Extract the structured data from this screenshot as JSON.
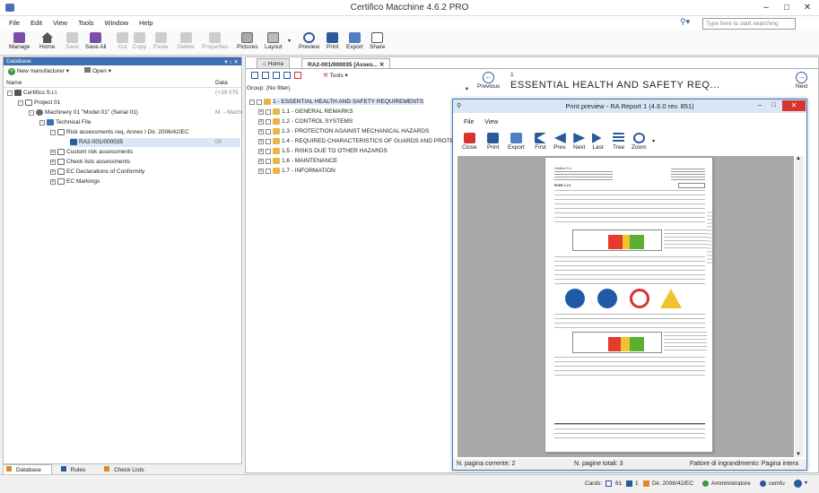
{
  "app_title": "Certifico Macchine 4.6.2 PRO",
  "menu": [
    "File",
    "Edit",
    "View",
    "Tools",
    "Window",
    "Help"
  ],
  "search_placeholder": "Type here to start searching",
  "toolbar": {
    "manage": "Manage",
    "home": "Home",
    "save": "Save",
    "save_all": "Save All",
    "cut": "Cut",
    "copy": "Copy",
    "paste": "Paste",
    "delete": "Delete",
    "properties": "Properties",
    "pictures": "Pictures",
    "layout": "Layout",
    "preview": "Preview",
    "print": "Print",
    "export": "Export",
    "share": "Share"
  },
  "database_panel": {
    "title": "Database",
    "new_manufacturer": "New manufacturer",
    "open": "Open",
    "col_name": "Name",
    "col_data": "Data",
    "tree": [
      {
        "label": "Certifico S.r.l.",
        "data": "(+39 075"
      },
      {
        "label": "Project 01",
        "data": ""
      },
      {
        "label": "Machinery 01 \"Model 01\" (Serial 01)",
        "data": "M. - Machi"
      },
      {
        "label": "Technical File",
        "data": ""
      },
      {
        "label": "Risk assessments req. Annex I Dir. 2006/42/EC",
        "data": ""
      },
      {
        "label": "RA2-001/000035",
        "data": "00"
      },
      {
        "label": "Custom risk assessments",
        "data": ""
      },
      {
        "label": "Check lists assessments",
        "data": ""
      },
      {
        "label": "EC Declarations of Conformity",
        "data": ""
      },
      {
        "label": "EC Markings",
        "data": ""
      }
    ],
    "bottom_tabs": [
      "Database",
      "Rules",
      "Check Lists"
    ]
  },
  "doc_tabs": {
    "home": "Home",
    "active": "RA2-001/000035 [Asses..."
  },
  "tools_label": "Tools",
  "group_filter": "Group: (No filter)",
  "requirements": [
    "1 - ESSENTIAL HEALTH AND SAFETY REQUIREMENTS",
    "1.1 - GENERAL REMARKS",
    "1.2 - CONTROL SYSTEMS",
    "1.3 - PROTECTION AGAINST MECHANICAL HAZARDS",
    "1.4 - REQUIRED CHARACTERISTICS OF GUARDS AND PROTECT",
    "1.5 - RISKS DUE TO OTHER HAZARDS",
    "1.6 - MAINTENANCE",
    "1.7 - INFORMATION"
  ],
  "nav": {
    "previous": "Previous",
    "next": "Next",
    "page_num": "1",
    "heading": "ESSENTIAL HEALTH AND SAFETY REQ..."
  },
  "preview": {
    "title": "Print preview - RA Report 1 (4.6.0 rev. 851)",
    "menu": [
      "File",
      "View"
    ],
    "buttons": [
      "Close",
      "Print",
      "Export",
      "First",
      "Prev.",
      "Next",
      "Last",
      "Tree",
      "Zoom"
    ],
    "status_current": "N. pagina corrente: 2",
    "status_total": "N. pagine totali: 3",
    "status_zoom": "Fattore di ingrandimento: Pagina intera"
  },
  "statusbar": {
    "cards_label": "Cards:",
    "cards_a": "61",
    "cards_b": "1",
    "directive": "Dir. 2006/42/EC",
    "role": "Amministratore",
    "user": "cemfu"
  }
}
